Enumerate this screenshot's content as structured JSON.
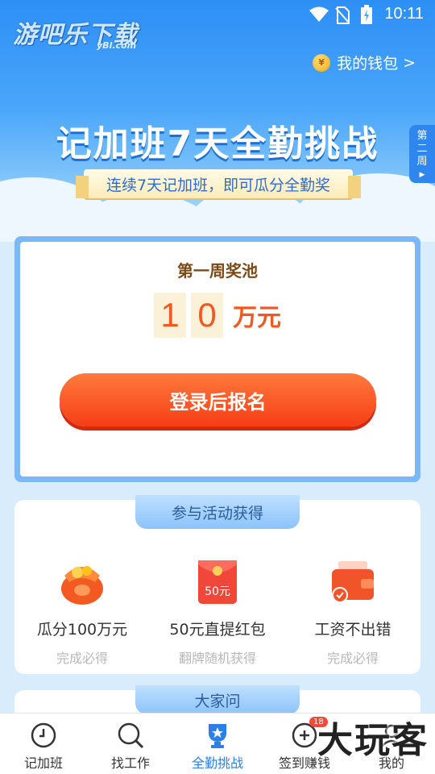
{
  "status_bar": {
    "time": "10:11"
  },
  "watermark": {
    "logo": "游吧乐下载",
    "sub": "yBl.com",
    "corner": "大玩客"
  },
  "header": {
    "wallet_label": "我的钱包",
    "wallet_arrow": ">",
    "title": "记加班7天全勤挑战",
    "ribbon": "连续7天记加班，即可瓜分全勤奖",
    "week_tab": [
      "第",
      "二",
      "周"
    ]
  },
  "pool": {
    "title": "第一周奖池",
    "digits": [
      "1",
      "0"
    ],
    "unit": "万元",
    "signup_button": "登录后报名"
  },
  "rewards": {
    "section_title": "参与活动获得",
    "items": [
      {
        "name": "瓜分100万元",
        "note": "完成必得",
        "icon": "money-bag-icon"
      },
      {
        "name": "50元直提红包",
        "note": "翻牌随机获得",
        "icon": "red-packet-icon",
        "badge": "50元"
      },
      {
        "name": "工资不出错",
        "note": "完成必得",
        "icon": "wallet-check-icon"
      }
    ]
  },
  "faq": {
    "section_title": "大家问"
  },
  "bottom_nav": {
    "items": [
      {
        "label": "记加班",
        "icon": "clock-icon"
      },
      {
        "label": "找工作",
        "icon": "search-icon"
      },
      {
        "label": "全勤挑战",
        "icon": "trophy-star-icon",
        "active": true
      },
      {
        "label": "签到赚钱",
        "icon": "checkin-icon",
        "badge": "18"
      },
      {
        "label": "我的",
        "icon": "profile-icon"
      }
    ]
  },
  "colors": {
    "primary": "#2d7fe8",
    "accent": "#f05a20",
    "button_red": "#f63d16"
  }
}
